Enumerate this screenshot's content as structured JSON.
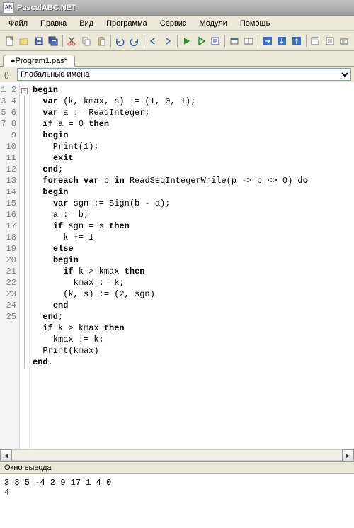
{
  "window": {
    "title": "PascalABC.NET"
  },
  "menu": {
    "file": "Файл",
    "edit": "Правка",
    "view": "Вид",
    "program": "Программа",
    "service": "Сервис",
    "modules": "Модули",
    "help": "Помощь"
  },
  "tab": {
    "name": "●Program1.pas*"
  },
  "scope": {
    "selected": "Глобальные имена"
  },
  "code": {
    "lines": [
      "begin",
      "  var (k, kmax, s) := (1, 0, 1);",
      "  var a := ReadInteger;",
      "  if a = 0 then",
      "  begin",
      "    Print(1);",
      "    exit",
      "  end;",
      "  foreach var b in ReadSeqIntegerWhile(p -> p <> 0) do",
      "  begin",
      "    var sgn := Sign(b - a);",
      "    a := b;",
      "    if sgn = s then",
      "      k += 1",
      "    else",
      "    begin",
      "      if k > kmax then",
      "        kmax := k;",
      "      (k, s) := (2, sgn)",
      "    end",
      "  end;",
      "  if k > kmax then",
      "    kmax := k;",
      "  Print(kmax)",
      "end."
    ]
  },
  "gutter": [
    "1",
    "2",
    "3",
    "4",
    "5",
    "6",
    "7",
    "8",
    "9",
    "10",
    "11",
    "12",
    "13",
    "14",
    "15",
    "16",
    "17",
    "18",
    "19",
    "20",
    "21",
    "22",
    "23",
    "24",
    "25"
  ],
  "output": {
    "title": "Окно вывода",
    "lines": [
      "3 8 5 -4 2 9 17 1 4 0",
      "4"
    ]
  }
}
